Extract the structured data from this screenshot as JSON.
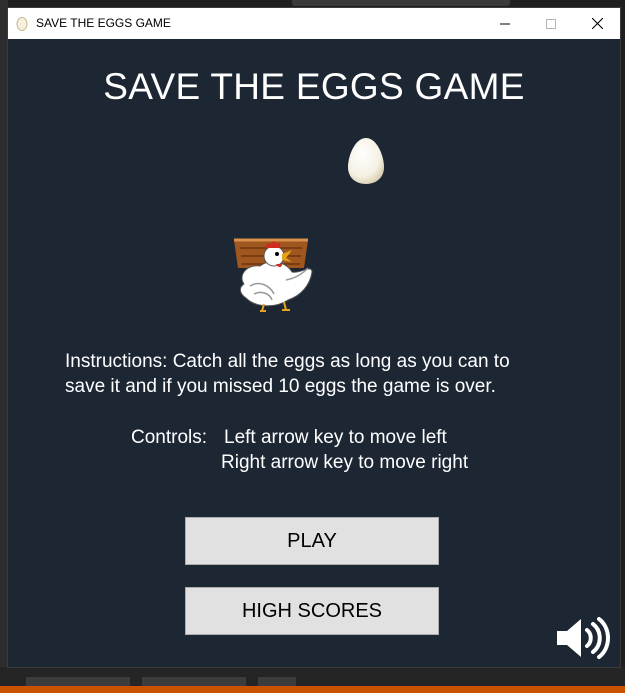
{
  "window": {
    "title": "SAVE THE EGGS GAME",
    "app_icon": "egg-icon",
    "controls": [
      "minimize-icon",
      "maximize-icon",
      "close-icon"
    ]
  },
  "game": {
    "title": "SAVE THE EGGS GAME",
    "instructions": "Instructions: Catch all the eggs as long as you can to\nsave it and if you missed 10 eggs the game is over.",
    "controls_label": "Controls:",
    "controls_left": "Left arrow key to move left",
    "controls_right": "Right arrow key to move right",
    "play_label": "PLAY",
    "high_scores_label": "HIGH SCORES",
    "sound_icon": "speaker-volume-icon"
  },
  "colors": {
    "window_background": "#1d2633",
    "button_background": "#e1e1e1",
    "text": "#ffffff",
    "taskbar_accent": "#ca5100"
  }
}
